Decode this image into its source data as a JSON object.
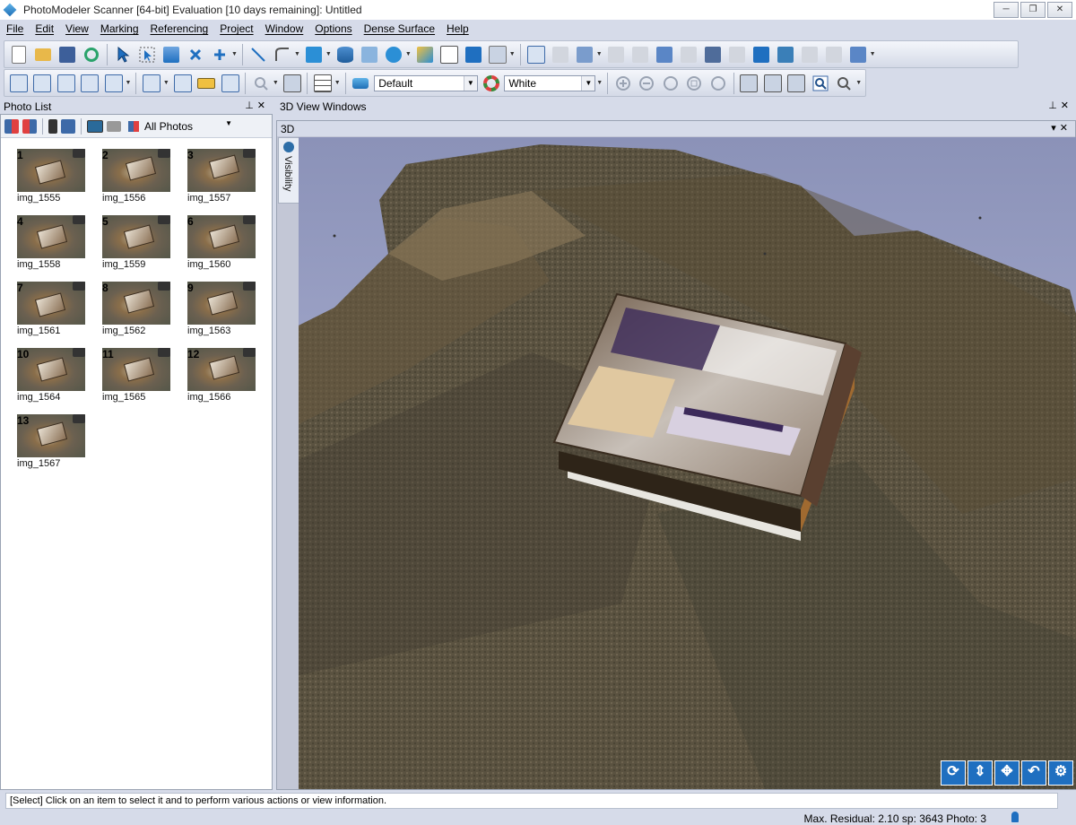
{
  "window": {
    "title": "PhotoModeler Scanner [64-bit] Evaluation [10 days remaining]: Untitled",
    "buttons": [
      "─",
      "❐",
      "✕"
    ]
  },
  "menu": [
    "File",
    "Edit",
    "View",
    "Marking",
    "Referencing",
    "Project",
    "Window",
    "Options",
    "Dense Surface",
    "Help"
  ],
  "toolbar2": {
    "style_value": "Default",
    "color_value": "White"
  },
  "photo_list": {
    "title": "Photo List",
    "filter_value": "All Photos",
    "photos": [
      {
        "num": "1",
        "label": "img_1555"
      },
      {
        "num": "2",
        "label": "img_1556"
      },
      {
        "num": "3",
        "label": "img_1557"
      },
      {
        "num": "4",
        "label": "img_1558"
      },
      {
        "num": "5",
        "label": "img_1559"
      },
      {
        "num": "6",
        "label": "img_1560"
      },
      {
        "num": "7",
        "label": "img_1561"
      },
      {
        "num": "8",
        "label": "img_1562"
      },
      {
        "num": "9",
        "label": "img_1563"
      },
      {
        "num": "10",
        "label": "img_1564"
      },
      {
        "num": "11",
        "label": "img_1565"
      },
      {
        "num": "12",
        "label": "img_1566"
      },
      {
        "num": "13",
        "label": "img_1567"
      }
    ]
  },
  "view3d": {
    "windows_title": "3D View Windows",
    "tab_label": "3D",
    "visibility_label": "Visibility"
  },
  "status": {
    "message": "[Select] Click on an item to select it and to perform various actions or view information.",
    "info": "Max. Residual: 2.10 sp: 3643 Photo: 3"
  },
  "colors": {
    "chrome": "#d6dbe9",
    "nav_button": "#1f6fc0",
    "sky": "#9aa0c4"
  }
}
